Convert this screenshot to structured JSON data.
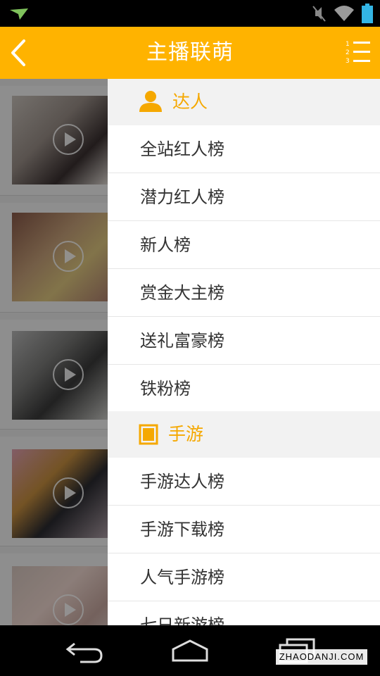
{
  "app_bar": {
    "title": "主播联萌",
    "bg_color": "#ffb300"
  },
  "status_bar": {
    "icons": [
      "app-notification-icon",
      "muted-icon",
      "wifi-icon",
      "battery-icon"
    ]
  },
  "drawer": {
    "sections": [
      {
        "label": "达人",
        "icon": "person-icon",
        "items": [
          "全站红人榜",
          "潜力红人榜",
          "新人榜",
          "赏金大主榜",
          "送礼富豪榜",
          "铁粉榜"
        ]
      },
      {
        "label": "手游",
        "icon": "square-icon",
        "items": [
          "手游达人榜",
          "手游下载榜",
          "人气手游榜",
          "七日新游榜"
        ]
      }
    ]
  },
  "video_list": {
    "card_count": 5
  },
  "watermark": "ZHAODANJI.COM"
}
